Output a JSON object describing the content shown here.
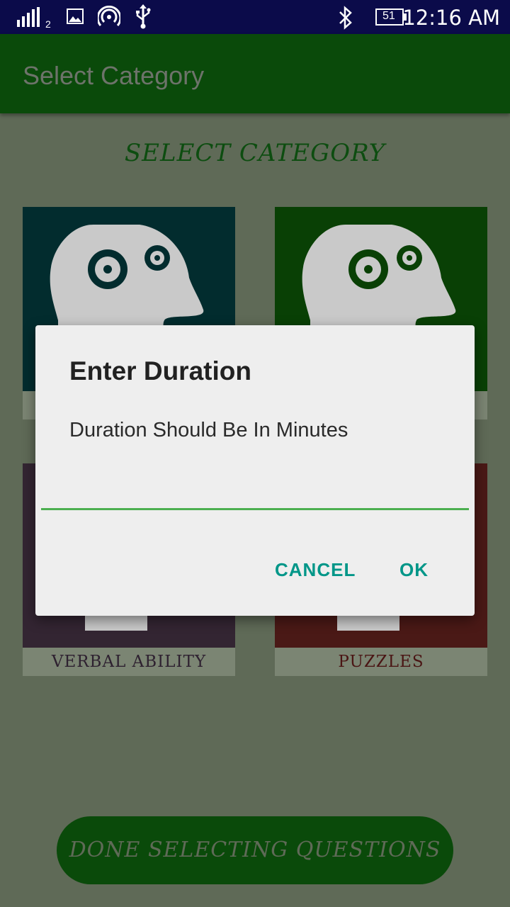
{
  "status_bar": {
    "time": "12:16 AM",
    "sim_label": "2",
    "battery": "51",
    "icons": [
      "signal-icon",
      "image-icon",
      "hotspot-icon",
      "usb-icon",
      "bluetooth-icon",
      "battery-icon"
    ]
  },
  "app_bar": {
    "title": "Select Category"
  },
  "page": {
    "heading": "SELECT CATEGORY"
  },
  "categories": [
    {
      "label": "",
      "color": "#022c2e"
    },
    {
      "label": "",
      "color": "#094005"
    },
    {
      "label": "VERBAL ABILITY",
      "color": "#332532"
    },
    {
      "label": "PUZZLES",
      "color": "#4a1916"
    }
  ],
  "done_button": {
    "label": "DONE SELECTING QUESTIONS"
  },
  "dialog": {
    "title": "Enter Duration",
    "message": "Duration Should Be In Minutes",
    "input_value": "",
    "cancel_label": "CANCEL",
    "ok_label": "OK",
    "accent_color": "#009688"
  },
  "colors": {
    "app_bar": "#0a4a0a",
    "status_bar": "#0b0b4a",
    "scrim_background": "#5f6a57"
  }
}
